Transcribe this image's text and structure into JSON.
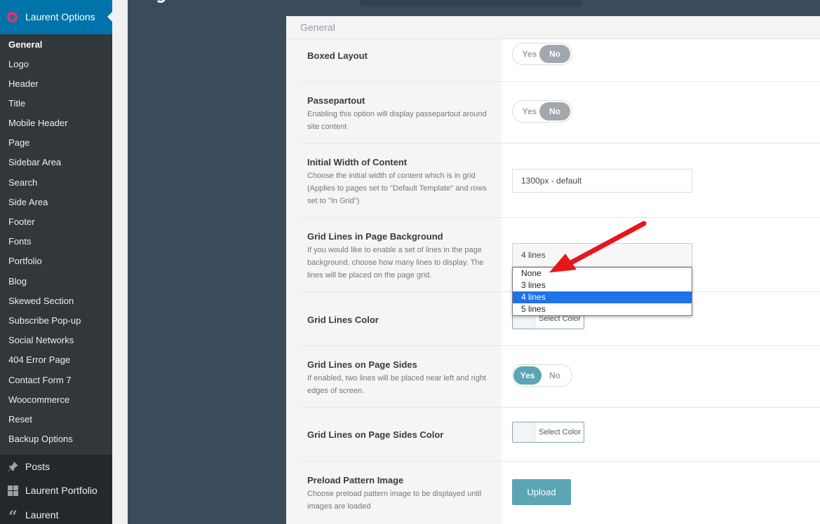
{
  "sidebar": {
    "current_menu": "Laurent Options",
    "submenu": [
      "General",
      "Logo",
      "Header",
      "Title",
      "Mobile Header",
      "Page",
      "Sidebar Area",
      "Search",
      "Side Area",
      "Footer",
      "Fonts",
      "Portfolio",
      "Blog",
      "Skewed Section",
      "Subscribe Pop-up",
      "Social Networks",
      "404 Error Page",
      "Contact Form 7",
      "Woocommerce",
      "Reset",
      "Backup Options"
    ],
    "bottom_menu": [
      {
        "label": "Posts",
        "icon": "pin-icon"
      },
      {
        "label": "Laurent Portfolio",
        "icon": "grid-icon"
      },
      {
        "label": "Laurent",
        "icon": "quote-icon"
      }
    ]
  },
  "section": {
    "title": "General"
  },
  "options": {
    "boxed_layout": {
      "title": "Boxed Layout",
      "yes": "Yes",
      "no": "No",
      "value": "No"
    },
    "passepartout": {
      "title": "Passepartout",
      "desc": "Enabling this option will display passepartout around site content",
      "yes": "Yes",
      "no": "No",
      "value": "No"
    },
    "initial_width": {
      "title": "Initial Width of Content",
      "desc": "Choose the initial width of content which is in grid (Applies to pages set to \"Default Template\" and rows set to \"In Grid\")",
      "value": "1300px - default"
    },
    "grid_lines": {
      "title": "Grid Lines in Page Background",
      "desc": "If you would like to enable a set of lines in the page background, choose how many lines to display. The lines will be placed on the page grid.",
      "value": "4 lines",
      "options": [
        "None",
        "3 lines",
        "4 lines",
        "5 lines"
      ],
      "selected_index": 2
    },
    "grid_lines_color": {
      "title": "Grid Lines Color",
      "button": "Select Color"
    },
    "grid_lines_sides": {
      "title": "Grid Lines on Page Sides",
      "desc": "If enabled, two lines will be placed near left and right edges of screen.",
      "yes": "Yes",
      "no": "No",
      "value": "Yes"
    },
    "grid_lines_sides_color": {
      "title": "Grid Lines on Page Sides Color",
      "button": "Select Color"
    },
    "preload_pattern": {
      "title": "Preload Pattern Image",
      "desc": "Choose preload pattern image to be displayed until images are loaded",
      "button": "Upload"
    }
  },
  "colors": {
    "accent": "#5ba5b5",
    "wp_blue": "#0073aa",
    "annotation_arrow": "#e8161b"
  }
}
